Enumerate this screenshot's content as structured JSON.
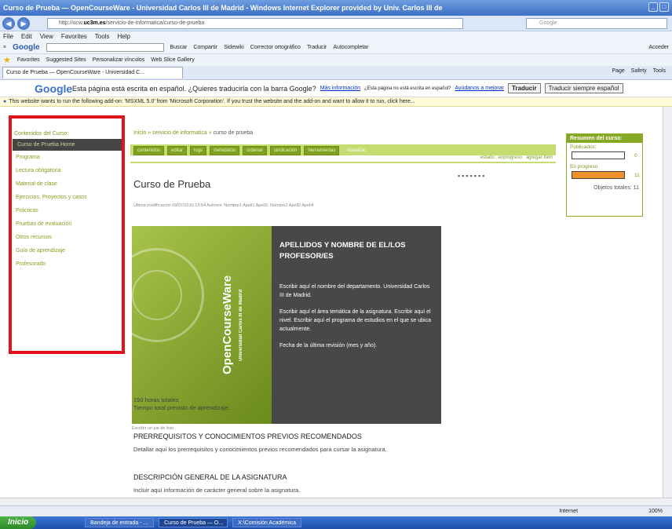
{
  "window": {
    "title": "Curso de Prueba — OpenCourseWare - Universidad Carlos III de Madrid - Windows Internet Explorer provided by Univ. Carlos III de"
  },
  "address": {
    "prefix": "http://ocw.",
    "host": "uc3m.es",
    "path": "/servicio-de-informatica/curso-de-prueba",
    "search_placeholder": "Google"
  },
  "menu": [
    "File",
    "Edit",
    "View",
    "Favorites",
    "Tools",
    "Help"
  ],
  "gtoolbar": {
    "logo": "Google",
    "items": [
      "Buscar",
      "Compartir",
      "Sidewiki",
      "Corrector ortográfico",
      "Traducir",
      "Autocompletar"
    ],
    "right": "Acceder"
  },
  "favorites": {
    "label": "Favorites",
    "items": [
      "Suggested Sites",
      "Personalizar vínculos",
      "Web Slice Gallery"
    ]
  },
  "tab": {
    "label": "Curso de Prueba — OpenCourseWare - Universidad C..."
  },
  "commands": [
    "Page",
    "Safety",
    "Tools"
  ],
  "translate": {
    "logo": "Google",
    "text": "Esta página está escrita en español. ¿Quieres traducirla con la barra Google?",
    "link1": "Más información",
    "small": "¿Esta página no está escrita en español?",
    "link2": "Ayúdanos a mejorar",
    "btn1": "Traducir",
    "btn2": "Traducir siempre español"
  },
  "infobar": {
    "text": "This website wants to run the following add-on: 'MSXML 5.0' from 'Microsoft Corporation'. If you trust the website and the add-on and want to allow it to run, click here..."
  },
  "sidebar": {
    "heading": "Contenidos del Curso:",
    "active": "Curso de Prueba Home",
    "items": [
      "Programa",
      "Lectura obligatoria",
      "Material de clase",
      "Ejercicios, Proyectos y casos",
      "Prácticas",
      "Pruebas de evaluación",
      "Otros recursos",
      "Guía de aprendizaje",
      "Profesorado"
    ]
  },
  "breadcrumb": {
    "start": "Inicio",
    "sep": "»",
    "mid": "servicio de informatica",
    "end": "curso de prueba"
  },
  "edit_tabs": [
    "contenidos",
    "editar",
    "logs",
    "metadatos",
    "ordenar",
    "sindicación",
    "herramientas",
    "visualizar"
  ],
  "state": {
    "estado": "estado:: enprogreso",
    "agregar": "agregar ítem"
  },
  "page": {
    "title": "Curso de Prueba",
    "modified": "Última modificación 09/07/2010 13:54 Autores: Nombre1 Apell1 Apell2, Nombre2 Apell2 Apell4"
  },
  "banner": {
    "brand": "OpenCourseWare",
    "univ": "Universidad Carlos III de Madrid",
    "heading": "APELLIDOS Y NOMBRE DE EL/LOS PROFESOR/ES",
    "p1": "Escribir aquí el nombre del departamento. Universidad Carlos III de Madrid.",
    "p2": "Escribir aquí el área temática de la asignatura. Escribir aquí el nivel. Escribir aquí el programa de estudios en el que se ubica actualmente.",
    "p3": "Fecha de la última revisión (mes y año).",
    "caption": "Escribir un pie de foto"
  },
  "hours": {
    "l1": "150 horas totales",
    "l2": "Tiempo total previsto de aprendizaje."
  },
  "sections": [
    {
      "title": "PRERREQUISITOS Y CONOCIMIENTOS PREVIOS RECOMENDADOS",
      "text": "Detallar aquí los prerrequisitos y conocimientos previos recomendados para cursar la asignatura."
    },
    {
      "title": "DESCRIPCIÓN GENERAL DE LA ASIGNATURA",
      "text": "Incluir aquí información de carácter general sobre la asignatura."
    }
  ],
  "summary": {
    "title": "Resumen del curso:",
    "published_label": "Publicados:",
    "published": "0",
    "progress_label": "En progreso:",
    "progress": "11",
    "total": "Objetos totales: 11"
  },
  "status": {
    "zone": "Internet",
    "zoom": "100%"
  },
  "taskbar": {
    "start": "Inicio",
    "tasks": [
      "Bandeja de entrada - ...",
      "Curso de Prueba — O...",
      "X:\\Comisión Académica"
    ]
  },
  "colors": {
    "accent": "#86a824",
    "highlight": "#e2141b",
    "progress": "#f0922a"
  }
}
